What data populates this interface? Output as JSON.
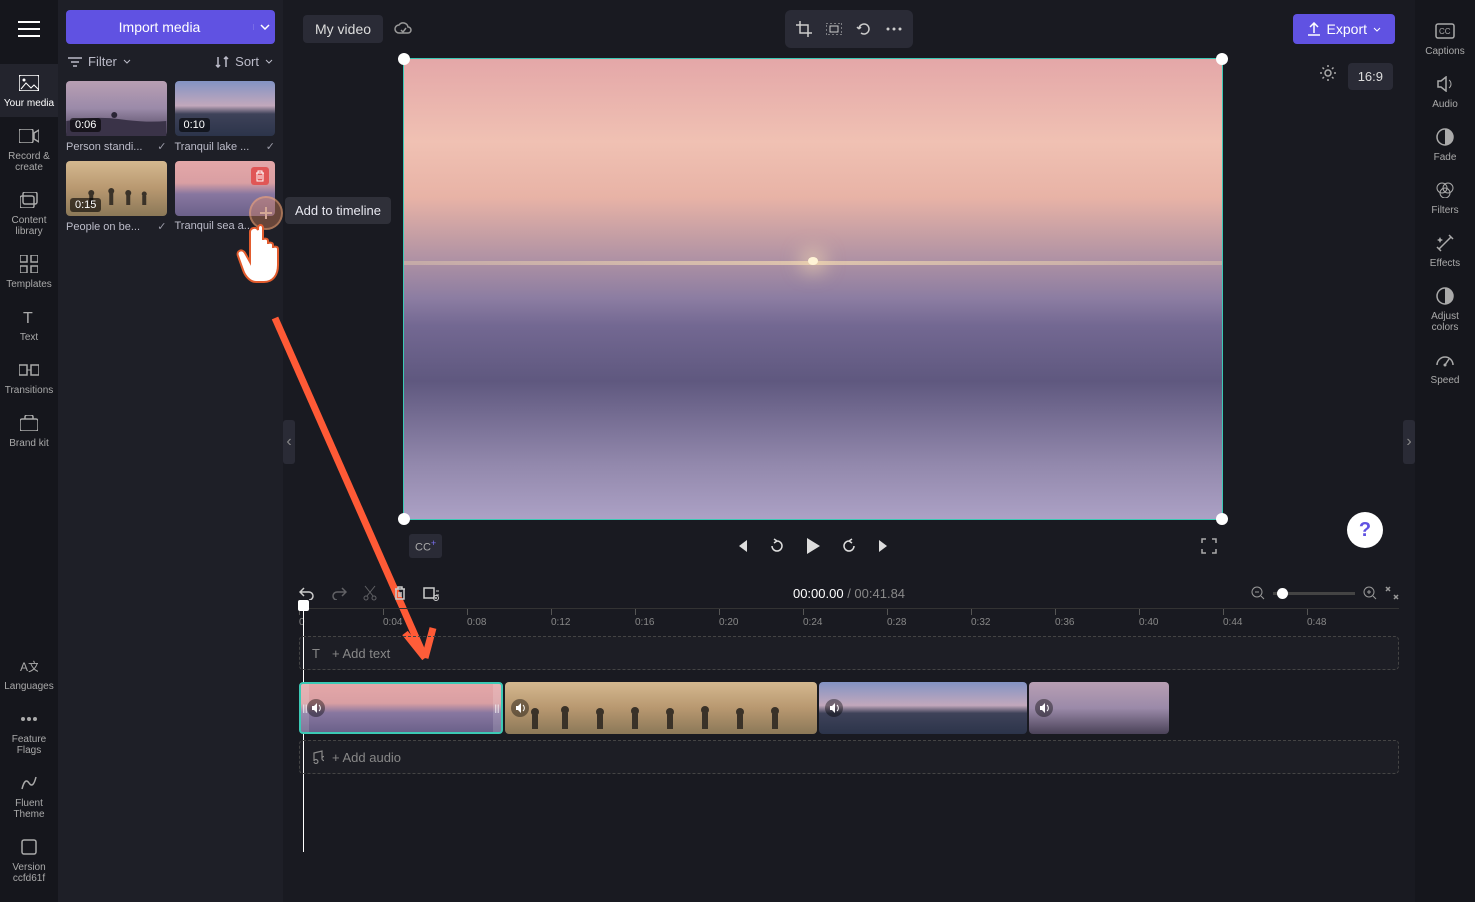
{
  "leftRail": {
    "items": [
      {
        "label": "Your media"
      },
      {
        "label": "Record & create"
      },
      {
        "label": "Content library"
      },
      {
        "label": "Templates"
      },
      {
        "label": "Text"
      },
      {
        "label": "Transitions"
      },
      {
        "label": "Brand kit"
      }
    ],
    "bottom": [
      {
        "label": "Languages"
      },
      {
        "label": "Feature Flags"
      },
      {
        "label": "Fluent Theme"
      },
      {
        "label": "Version ccfd61f"
      }
    ]
  },
  "mediaPanel": {
    "importLabel": "Import media",
    "filterLabel": "Filter",
    "sortLabel": "Sort",
    "thumbs": [
      {
        "dur": "0:06",
        "cap": "Person standi...",
        "checked": true
      },
      {
        "dur": "0:10",
        "cap": "Tranquil lake ...",
        "checked": true
      },
      {
        "dur": "0:15",
        "cap": "People on be...",
        "checked": true
      },
      {
        "dur": "",
        "cap": "Tranquil sea a...",
        "checked": false
      }
    ],
    "tooltip": "Add to timeline"
  },
  "top": {
    "title": "My video",
    "exportLabel": "Export",
    "aspect": "16:9"
  },
  "player": {
    "current": "00:00.00",
    "total": "00:41.84"
  },
  "timeline": {
    "addText": "+ Add text",
    "addAudio": "+ Add audio",
    "ticks": [
      "0",
      "0:04",
      "0:08",
      "0:12",
      "0:16",
      "0:20",
      "0:24",
      "0:28",
      "0:32",
      "0:36",
      "0:40",
      "0:44",
      "0:48"
    ]
  },
  "rightRail": {
    "items": [
      {
        "label": "Captions"
      },
      {
        "label": "Audio"
      },
      {
        "label": "Fade"
      },
      {
        "label": "Filters"
      },
      {
        "label": "Effects"
      },
      {
        "label": "Adjust colors"
      },
      {
        "label": "Speed"
      }
    ]
  }
}
